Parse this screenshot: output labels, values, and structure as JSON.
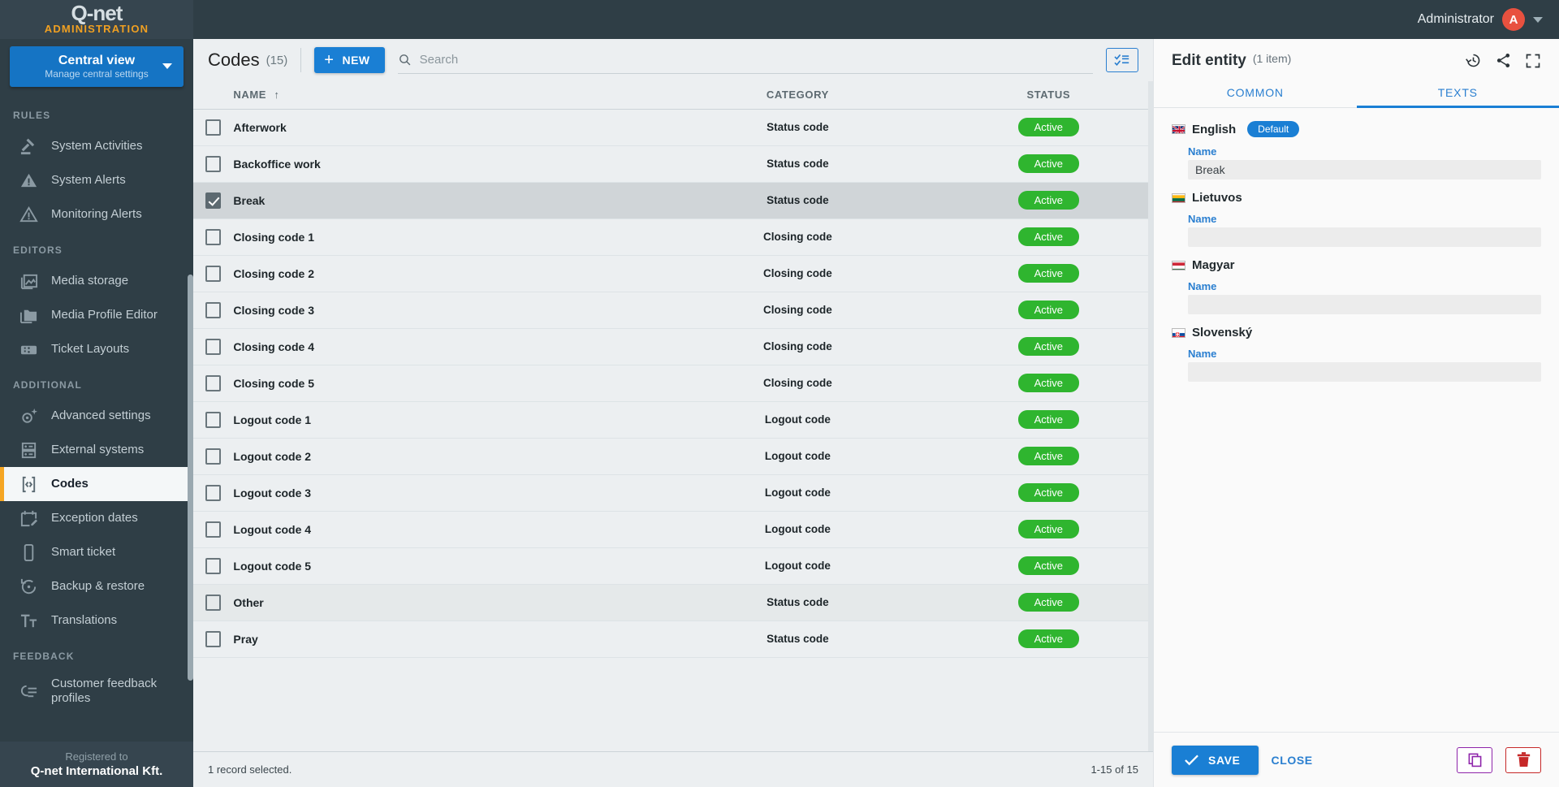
{
  "topbar": {
    "logo": "Q-net",
    "logo_sub": "ADMINISTRATION",
    "user_name": "Administrator",
    "avatar_initial": "A"
  },
  "sidebar": {
    "view_switch": {
      "title": "Central view",
      "subtitle": "Manage central settings"
    },
    "groups": [
      {
        "label": "RULES",
        "items": [
          {
            "label": "System Activities",
            "icon": "gavel-icon",
            "active": false
          },
          {
            "label": "System Alerts",
            "icon": "alert-filled-icon",
            "active": false
          },
          {
            "label": "Monitoring Alerts",
            "icon": "alert-outline-icon",
            "active": false
          }
        ]
      },
      {
        "label": "EDITORS",
        "items": [
          {
            "label": "Media storage",
            "icon": "image-stack-icon",
            "active": false
          },
          {
            "label": "Media Profile Editor",
            "icon": "media-profile-icon",
            "active": false
          },
          {
            "label": "Ticket Layouts",
            "icon": "ticket-icon",
            "active": false
          }
        ]
      },
      {
        "label": "ADDITIONAL",
        "items": [
          {
            "label": "Advanced settings",
            "icon": "gear-sparkle-icon",
            "active": false
          },
          {
            "label": "External systems",
            "icon": "server-icon",
            "active": false
          },
          {
            "label": "Codes",
            "icon": "code-brackets-icon",
            "active": true
          },
          {
            "label": "Exception dates",
            "icon": "calendar-edit-icon",
            "active": false
          },
          {
            "label": "Smart ticket",
            "icon": "mobile-icon",
            "active": false
          },
          {
            "label": "Backup & restore",
            "icon": "restore-icon",
            "active": false
          },
          {
            "label": "Translations",
            "icon": "translate-icon",
            "active": false
          }
        ]
      },
      {
        "label": "FEEDBACK",
        "items": [
          {
            "label": "Customer feedback profiles",
            "icon": "feedback-icon",
            "active": false,
            "two_line": true
          }
        ]
      }
    ],
    "registered_to_label": "Registered to",
    "registered_to_name": "Q-net International Kft."
  },
  "main": {
    "title": "Codes",
    "count_label": "(15)",
    "new_button": "NEW",
    "search_placeholder": "Search",
    "search_value": "",
    "columns": [
      "NAME",
      "CATEGORY",
      "STATUS"
    ],
    "sort_column": "NAME",
    "sort_direction": "asc",
    "rows": [
      {
        "name": "Afterwork",
        "category": "Status code",
        "status": "Active",
        "checked": false,
        "state": "normal"
      },
      {
        "name": "Backoffice work",
        "category": "Status code",
        "status": "Active",
        "checked": false,
        "state": "normal"
      },
      {
        "name": "Break",
        "category": "Status code",
        "status": "Active",
        "checked": true,
        "state": "selected"
      },
      {
        "name": "Closing code 1",
        "category": "Closing code",
        "status": "Active",
        "checked": false,
        "state": "normal"
      },
      {
        "name": "Closing code 2",
        "category": "Closing code",
        "status": "Active",
        "checked": false,
        "state": "normal"
      },
      {
        "name": "Closing code 3",
        "category": "Closing code",
        "status": "Active",
        "checked": false,
        "state": "normal"
      },
      {
        "name": "Closing code 4",
        "category": "Closing code",
        "status": "Active",
        "checked": false,
        "state": "normal"
      },
      {
        "name": "Closing code 5",
        "category": "Closing code",
        "status": "Active",
        "checked": false,
        "state": "normal"
      },
      {
        "name": "Logout code 1",
        "category": "Logout code",
        "status": "Active",
        "checked": false,
        "state": "normal"
      },
      {
        "name": "Logout code 2",
        "category": "Logout code",
        "status": "Active",
        "checked": false,
        "state": "normal"
      },
      {
        "name": "Logout code 3",
        "category": "Logout code",
        "status": "Active",
        "checked": false,
        "state": "normal"
      },
      {
        "name": "Logout code 4",
        "category": "Logout code",
        "status": "Active",
        "checked": false,
        "state": "normal"
      },
      {
        "name": "Logout code 5",
        "category": "Logout code",
        "status": "Active",
        "checked": false,
        "state": "normal"
      },
      {
        "name": "Other",
        "category": "Status code",
        "status": "Active",
        "checked": false,
        "state": "hovered"
      },
      {
        "name": "Pray",
        "category": "Status code",
        "status": "Active",
        "checked": false,
        "state": "normal"
      }
    ],
    "footer_left": "1 record selected.",
    "footer_right": "1-15 of 15"
  },
  "panel": {
    "title": "Edit entity",
    "subtitle": "(1 item)",
    "tabs": [
      {
        "label": "COMMON",
        "active": false
      },
      {
        "label": "TEXTS",
        "active": true
      }
    ],
    "languages": [
      {
        "name": "English",
        "flag": "gb",
        "default_chip": "Default",
        "field_label": "Name",
        "value": "Break"
      },
      {
        "name": "Lietuvos",
        "flag": "lt",
        "default_chip": "",
        "field_label": "Name",
        "value": ""
      },
      {
        "name": "Magyar",
        "flag": "hu",
        "default_chip": "",
        "field_label": "Name",
        "value": ""
      },
      {
        "name": "Slovenský",
        "flag": "sk",
        "default_chip": "",
        "field_label": "Name",
        "value": ""
      }
    ],
    "save_label": "SAVE",
    "close_label": "CLOSE"
  },
  "colors": {
    "accent_blue": "#1a7fd4",
    "sidebar_bg": "#2f3e46",
    "active_marker": "#f5a623",
    "status_green": "#2fb52f",
    "avatar_red": "#e8513f",
    "copy_purple": "#8e24aa",
    "delete_red": "#c62828"
  }
}
